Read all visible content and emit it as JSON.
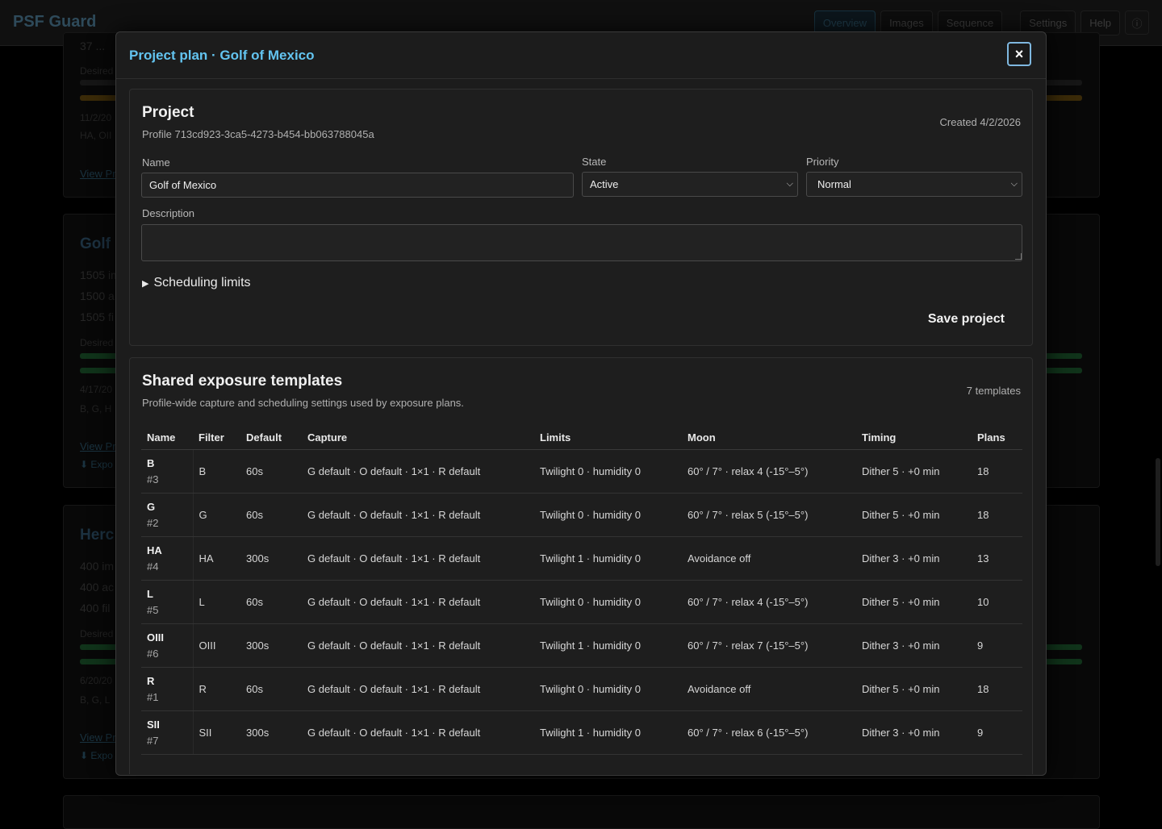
{
  "app": {
    "title": "PSF Guard",
    "nav": [
      "Overview",
      "Images",
      "Sequence",
      "Settings",
      "Help"
    ],
    "info_glyph": "ⓘ"
  },
  "background": {
    "card1": {
      "top_text": "37 ...",
      "desired": "Desired",
      "date": "11/2/20",
      "filters": "HA, OII",
      "link": "View Pr"
    },
    "card2": {
      "title": "Golf o",
      "lines": [
        "1505 im",
        "1500 a",
        "1505 fi"
      ],
      "desired": "Desired",
      "date": "4/17/20",
      "filters": "B, G, H",
      "link": "View Pr",
      "export": "⬇ Expo"
    },
    "card3": {
      "title": "Herc",
      "lines": [
        "400 im",
        "400 ac",
        "400 fil"
      ],
      "desired": "Desired",
      "date": "6/20/20",
      "filters": "B, G, L",
      "link": "View Pr",
      "export": "⬇ Expo"
    }
  },
  "modal": {
    "title": "Project plan · Golf of Mexico",
    "close_glyph": "×",
    "project": {
      "heading": "Project",
      "profile": "Profile 713cd923-3ca5-4273-b454-bb063788045a",
      "created": "Created 4/2/2026",
      "name_label": "Name",
      "name_value": "Golf of Mexico",
      "state_label": "State",
      "state_value": "Active",
      "priority_label": "Priority",
      "priority_value": "Normal",
      "description_label": "Description",
      "description_value": "",
      "scheduling_limits": "Scheduling limits",
      "save_label": "Save project"
    },
    "templates": {
      "heading": "Shared exposure templates",
      "subtitle": "Profile-wide capture and scheduling settings used by exposure plans.",
      "count": "7 templates",
      "columns": [
        "Name",
        "Filter",
        "Default",
        "Capture",
        "Limits",
        "Moon",
        "Timing",
        "Plans"
      ],
      "rows": [
        {
          "name": "B",
          "id": "#3",
          "filter": "B",
          "default": "60s",
          "capture": "G default · O default · 1×1 · R default",
          "limits": "Twilight 0 · humidity 0",
          "moon": "60° / 7° · relax 4 (-15°–5°)",
          "timing": "Dither 5 · +0 min",
          "plans": "18"
        },
        {
          "name": "G",
          "id": "#2",
          "filter": "G",
          "default": "60s",
          "capture": "G default · O default · 1×1 · R default",
          "limits": "Twilight 0 · humidity 0",
          "moon": "60° / 7° · relax 5 (-15°–5°)",
          "timing": "Dither 5 · +0 min",
          "plans": "18"
        },
        {
          "name": "HA",
          "id": "#4",
          "filter": "HA",
          "default": "300s",
          "capture": "G default · O default · 1×1 · R default",
          "limits": "Twilight 1 · humidity 0",
          "moon": "Avoidance off",
          "timing": "Dither 3 · +0 min",
          "plans": "13"
        },
        {
          "name": "L",
          "id": "#5",
          "filter": "L",
          "default": "60s",
          "capture": "G default · O default · 1×1 · R default",
          "limits": "Twilight 0 · humidity 0",
          "moon": "60° / 7° · relax 4 (-15°–5°)",
          "timing": "Dither 5 · +0 min",
          "plans": "10"
        },
        {
          "name": "OIII",
          "id": "#6",
          "filter": "OIII",
          "default": "300s",
          "capture": "G default · O default · 1×1 · R default",
          "limits": "Twilight 1 · humidity 0",
          "moon": "60° / 7° · relax 7 (-15°–5°)",
          "timing": "Dither 3 · +0 min",
          "plans": "9"
        },
        {
          "name": "R",
          "id": "#1",
          "filter": "R",
          "default": "60s",
          "capture": "G default · O default · 1×1 · R default",
          "limits": "Twilight 0 · humidity 0",
          "moon": "Avoidance off",
          "timing": "Dither 5 · +0 min",
          "plans": "18"
        },
        {
          "name": "SII",
          "id": "#7",
          "filter": "SII",
          "default": "300s",
          "capture": "G default · O default · 1×1 · R default",
          "limits": "Twilight 1 · humidity 0",
          "moon": "60° / 7° · relax 6 (-15°–5°)",
          "timing": "Dither 3 · +0 min",
          "plans": "9"
        }
      ]
    }
  }
}
